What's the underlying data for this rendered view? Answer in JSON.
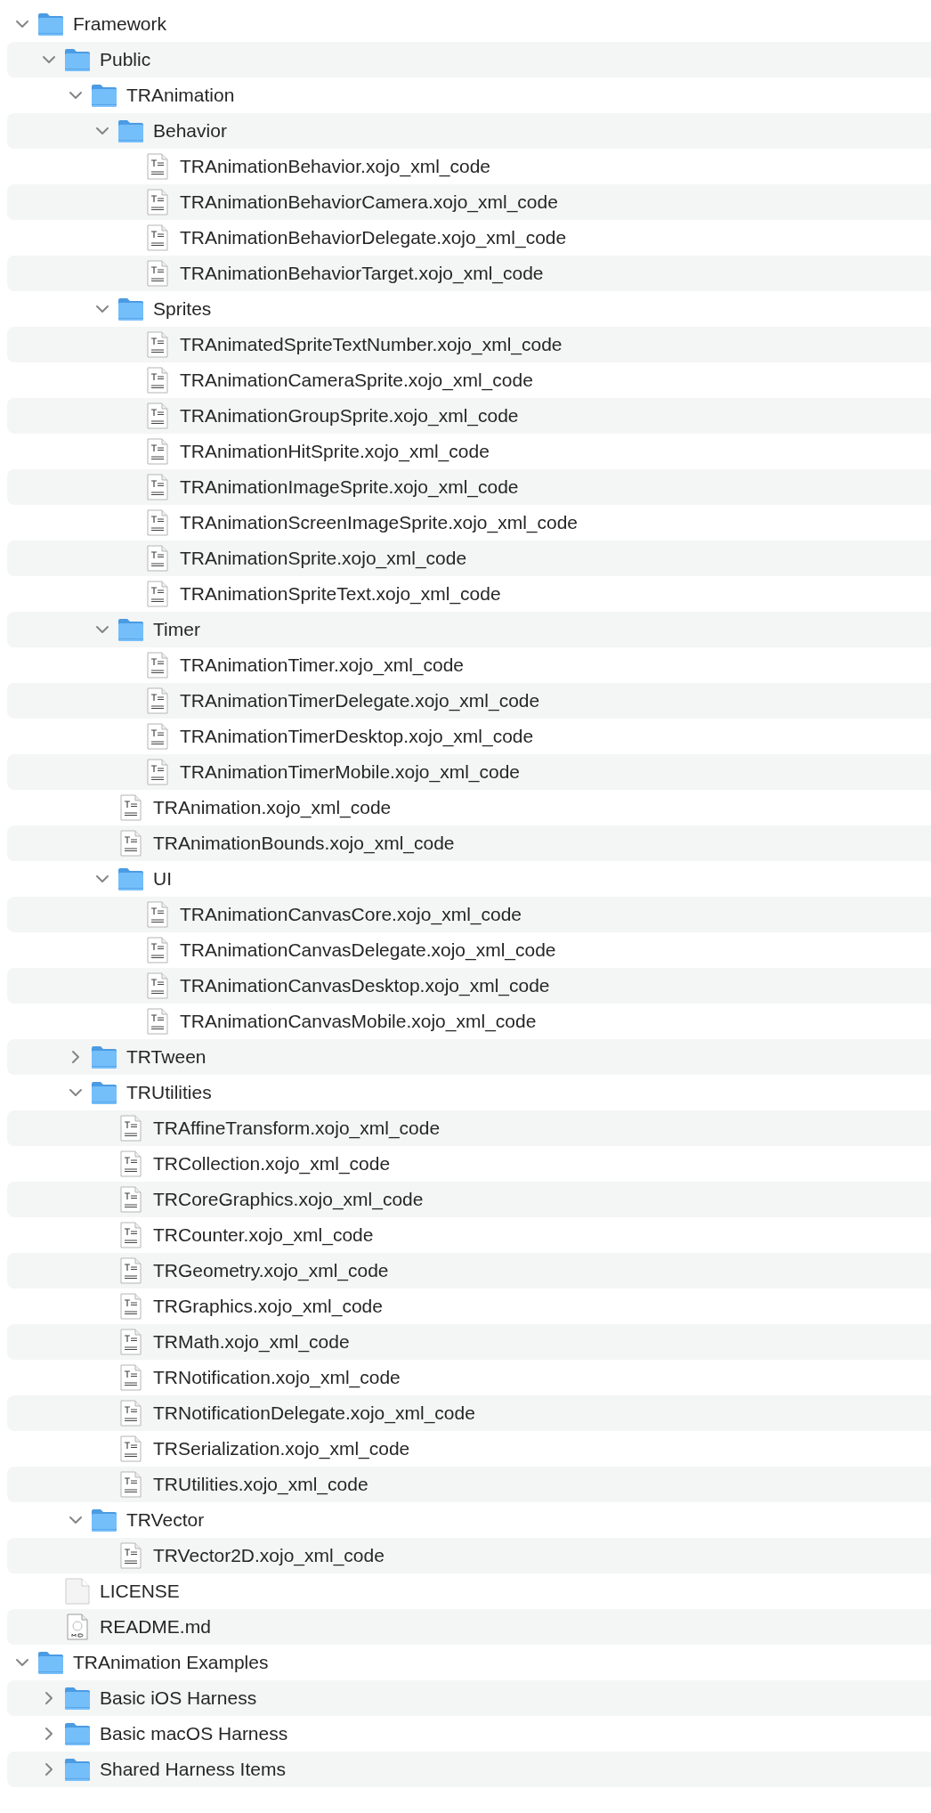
{
  "tree": [
    {
      "name": "Framework",
      "kind": "folder",
      "expanded": true,
      "children": [
        {
          "name": "Public",
          "kind": "folder",
          "expanded": true,
          "children": [
            {
              "name": "TRAnimation",
              "kind": "folder",
              "expanded": true,
              "children": [
                {
                  "name": "Behavior",
                  "kind": "folder",
                  "expanded": true,
                  "children": [
                    {
                      "name": "TRAnimationBehavior.xojo_xml_code",
                      "kind": "text"
                    },
                    {
                      "name": "TRAnimationBehaviorCamera.xojo_xml_code",
                      "kind": "text"
                    },
                    {
                      "name": "TRAnimationBehaviorDelegate.xojo_xml_code",
                      "kind": "text"
                    },
                    {
                      "name": "TRAnimationBehaviorTarget.xojo_xml_code",
                      "kind": "text"
                    }
                  ]
                },
                {
                  "name": "Sprites",
                  "kind": "folder",
                  "expanded": true,
                  "children": [
                    {
                      "name": "TRAnimatedSpriteTextNumber.xojo_xml_code",
                      "kind": "text"
                    },
                    {
                      "name": "TRAnimationCameraSprite.xojo_xml_code",
                      "kind": "text"
                    },
                    {
                      "name": "TRAnimationGroupSprite.xojo_xml_code",
                      "kind": "text"
                    },
                    {
                      "name": "TRAnimationHitSprite.xojo_xml_code",
                      "kind": "text"
                    },
                    {
                      "name": "TRAnimationImageSprite.xojo_xml_code",
                      "kind": "text"
                    },
                    {
                      "name": "TRAnimationScreenImageSprite.xojo_xml_code",
                      "kind": "text"
                    },
                    {
                      "name": "TRAnimationSprite.xojo_xml_code",
                      "kind": "text"
                    },
                    {
                      "name": "TRAnimationSpriteText.xojo_xml_code",
                      "kind": "text"
                    }
                  ]
                },
                {
                  "name": "Timer",
                  "kind": "folder",
                  "expanded": true,
                  "children": [
                    {
                      "name": "TRAnimationTimer.xojo_xml_code",
                      "kind": "text"
                    },
                    {
                      "name": "TRAnimationTimerDelegate.xojo_xml_code",
                      "kind": "text"
                    },
                    {
                      "name": "TRAnimationTimerDesktop.xojo_xml_code",
                      "kind": "text"
                    },
                    {
                      "name": "TRAnimationTimerMobile.xojo_xml_code",
                      "kind": "text"
                    }
                  ]
                },
                {
                  "name": "TRAnimation.xojo_xml_code",
                  "kind": "text"
                },
                {
                  "name": "TRAnimationBounds.xojo_xml_code",
                  "kind": "text"
                },
                {
                  "name": "UI",
                  "kind": "folder",
                  "expanded": true,
                  "children": [
                    {
                      "name": "TRAnimationCanvasCore.xojo_xml_code",
                      "kind": "text"
                    },
                    {
                      "name": "TRAnimationCanvasDelegate.xojo_xml_code",
                      "kind": "text"
                    },
                    {
                      "name": "TRAnimationCanvasDesktop.xojo_xml_code",
                      "kind": "text"
                    },
                    {
                      "name": "TRAnimationCanvasMobile.xojo_xml_code",
                      "kind": "text"
                    }
                  ]
                }
              ]
            },
            {
              "name": "TRTween",
              "kind": "folder",
              "expanded": false
            },
            {
              "name": "TRUtilities",
              "kind": "folder",
              "expanded": true,
              "children": [
                {
                  "name": "TRAffineTransform.xojo_xml_code",
                  "kind": "text"
                },
                {
                  "name": "TRCollection.xojo_xml_code",
                  "kind": "text"
                },
                {
                  "name": "TRCoreGraphics.xojo_xml_code",
                  "kind": "text"
                },
                {
                  "name": "TRCounter.xojo_xml_code",
                  "kind": "text"
                },
                {
                  "name": "TRGeometry.xojo_xml_code",
                  "kind": "text"
                },
                {
                  "name": "TRGraphics.xojo_xml_code",
                  "kind": "text"
                },
                {
                  "name": "TRMath.xojo_xml_code",
                  "kind": "text"
                },
                {
                  "name": "TRNotification.xojo_xml_code",
                  "kind": "text"
                },
                {
                  "name": "TRNotificationDelegate.xojo_xml_code",
                  "kind": "text"
                },
                {
                  "name": "TRSerialization.xojo_xml_code",
                  "kind": "text"
                },
                {
                  "name": "TRUtilities.xojo_xml_code",
                  "kind": "text"
                }
              ]
            },
            {
              "name": "TRVector",
              "kind": "folder",
              "expanded": true,
              "children": [
                {
                  "name": "TRVector2D.xojo_xml_code",
                  "kind": "text"
                }
              ]
            }
          ]
        },
        {
          "name": "LICENSE",
          "kind": "blank"
        },
        {
          "name": "README.md",
          "kind": "markdown"
        }
      ]
    },
    {
      "name": "TRAnimation Examples",
      "kind": "folder",
      "expanded": true,
      "children": [
        {
          "name": "Basic iOS Harness",
          "kind": "folder",
          "expanded": false
        },
        {
          "name": "Basic macOS Harness",
          "kind": "folder",
          "expanded": false
        },
        {
          "name": "Shared Harness Items",
          "kind": "folder",
          "expanded": false
        }
      ]
    }
  ]
}
